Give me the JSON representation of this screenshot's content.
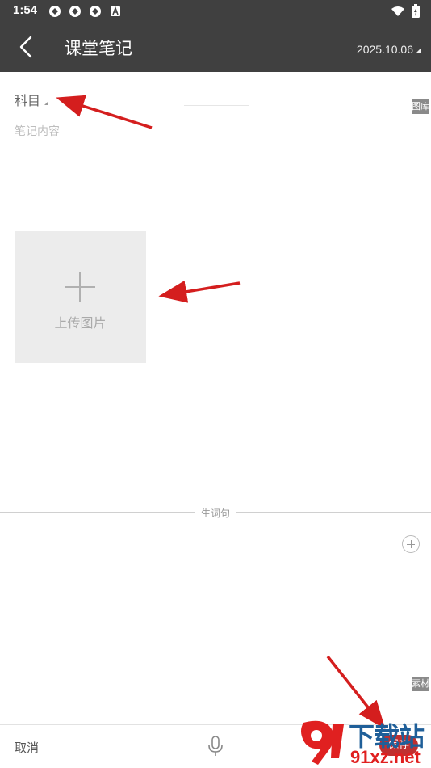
{
  "status_bar": {
    "time": "1:54",
    "left_icons": [
      "app-notification-icon",
      "app-notification-icon",
      "app-notification-icon",
      "a-keyboard-icon"
    ],
    "right_icons": [
      "wifi-icon",
      "battery-charging-icon"
    ]
  },
  "header": {
    "title": "课堂笔记",
    "date": "2025.10.06",
    "background": "#404040"
  },
  "form": {
    "subject_label": "科目",
    "content_placeholder": "笔记内容",
    "upload_label": "上传图片"
  },
  "side_tabs": {
    "gallery": "图库",
    "material": "素材"
  },
  "vocab": {
    "section_label": "生词句"
  },
  "bottom_bar": {
    "cancel_label": "取消",
    "save_label": "保存"
  },
  "watermark": {
    "top_text": "下载站",
    "bottom_text": "91xz.net",
    "accent": "#e02020",
    "brand": "#1f5f99"
  }
}
